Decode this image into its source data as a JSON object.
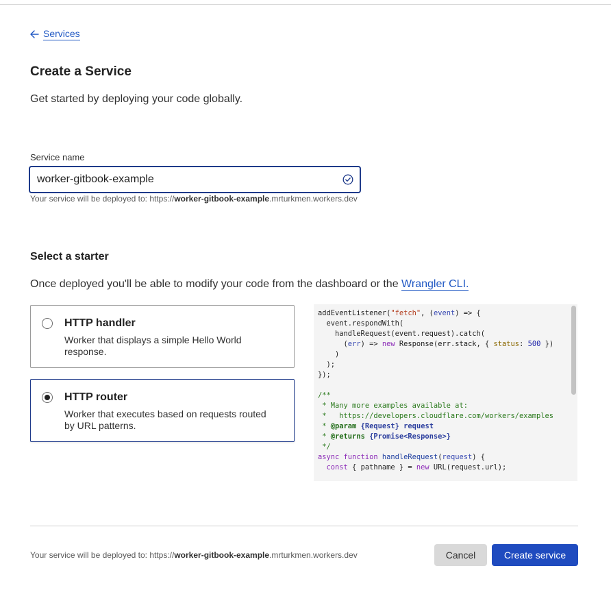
{
  "breadcrumb": {
    "back_label": "Services"
  },
  "page": {
    "title": "Create a Service",
    "subtitle": "Get started by deploying your code globally."
  },
  "service_name": {
    "label": "Service name",
    "value": "worker-gitbook-example",
    "hint_prefix": "Your service will be deployed to: https://",
    "hint_name": "worker-gitbook-example",
    "hint_suffix": ".mrturkmen.workers.dev"
  },
  "starter": {
    "heading": "Select a starter",
    "description": "Once deployed you'll be able to modify your code from the dashboard or the ",
    "link": "Wrangler CLI.",
    "options": [
      {
        "title": "HTTP handler",
        "description": "Worker that displays a simple Hello World response.",
        "selected": false
      },
      {
        "title": "HTTP router",
        "description": "Worker that executes based on requests routed by URL patterns.",
        "selected": true
      }
    ]
  },
  "code_preview": {
    "lines": [
      "addEventListener(\"fetch\", (event) => {",
      "  event.respondWith(",
      "    handleRequest(event.request).catch(",
      "      (err) => new Response(err.stack, { status: 500 })",
      "    )",
      "  );",
      "});",
      "",
      "/**",
      " * Many more examples available at:",
      " *   https://developers.cloudflare.com/workers/examples",
      " * @param {Request} request",
      " * @returns {Promise<Response>}",
      " */",
      "async function handleRequest(request) {",
      "  const { pathname } = new URL(request.url);"
    ]
  },
  "footer": {
    "hint_prefix": "Your service will be deployed to: https://",
    "hint_name": "worker-gitbook-example",
    "hint_suffix": ".mrturkmen.workers.dev",
    "cancel_label": "Cancel",
    "create_label": "Create service"
  },
  "colors": {
    "accent": "#1f4bbf",
    "focus_border": "#1e3a8a",
    "link": "#1f57c3"
  }
}
